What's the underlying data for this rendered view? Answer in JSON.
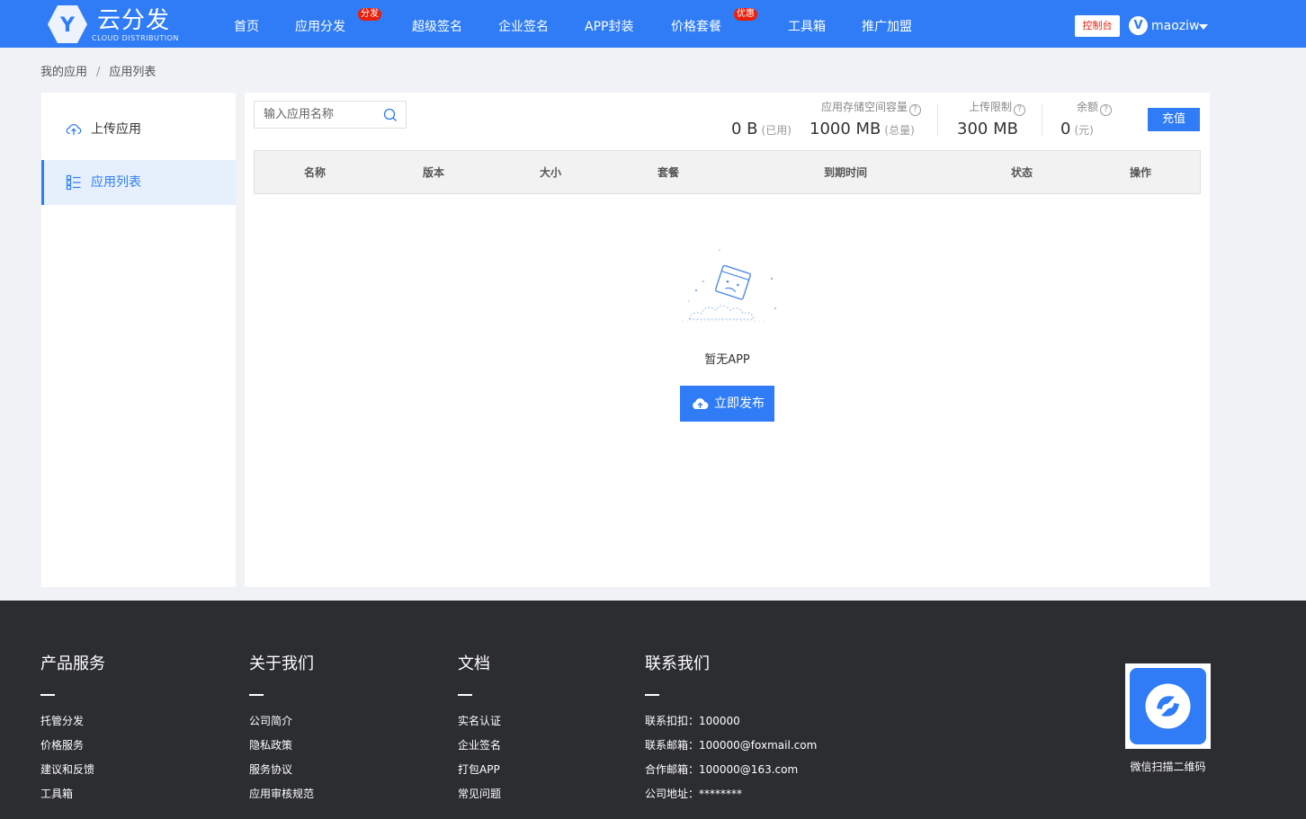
{
  "header": {
    "logo_letter": "Y",
    "logo_name": "云分发",
    "logo_sub": "CLOUD DISTRIBUTION",
    "nav": [
      {
        "label": "首页"
      },
      {
        "label": "应用分发",
        "badge": "分发"
      },
      {
        "label": "超级签名"
      },
      {
        "label": "企业签名"
      },
      {
        "label": "APP封装"
      },
      {
        "label": "价格套餐",
        "badge": "优惠"
      },
      {
        "label": "工具箱"
      },
      {
        "label": "推广加盟"
      }
    ],
    "console": "控制台",
    "user_initial": "V",
    "username": "maoziw"
  },
  "breadcrumb": [
    "我的应用",
    "应用列表"
  ],
  "breadcrumb_sep": "/",
  "sidebar": {
    "items": [
      {
        "label": "上传应用",
        "icon": "cloud-upload-icon"
      },
      {
        "label": "应用列表",
        "icon": "list-icon",
        "active": true
      }
    ]
  },
  "main": {
    "search_placeholder": "输入应用名称",
    "stats": {
      "storage_label": "应用存储空间容量",
      "used_value": "0 B",
      "used_unit": "(已用)",
      "total_value": "1000 MB",
      "total_unit": "(总量)",
      "upload_label": "上传限制",
      "upload_value": "300 MB",
      "balance_label": "余额",
      "balance_value": "0",
      "balance_unit": "(元)"
    },
    "recharge": "充值",
    "columns": [
      "名称",
      "版本",
      "大小",
      "套餐",
      "到期时间",
      "状态",
      "操作"
    ],
    "empty_text": "暂无APP",
    "publish_button": "立即发布"
  },
  "footer": {
    "columns": [
      {
        "title": "产品服务",
        "links": [
          "托管分发",
          "价格服务",
          "建议和反馈",
          "工具箱"
        ]
      },
      {
        "title": "关于我们",
        "links": [
          "公司简介",
          "隐私政策",
          "服务协议",
          "应用审核规范"
        ]
      },
      {
        "title": "文档",
        "links": [
          "实名认证",
          "企业签名",
          "打包APP",
          "常见问题"
        ]
      },
      {
        "title": "联系我们",
        "links": [
          "联系扣扣：100000",
          "联系邮箱：100000@foxmail.com",
          "合作邮箱：100000@163.com",
          "公司地址：********"
        ]
      }
    ],
    "qr_label": "微信扫描二维码"
  },
  "colors": {
    "primary": "#2f7cf6",
    "badge_red": "#e8200c",
    "footer_bg": "#2c2d30",
    "page_bg": "#f0f2f5"
  }
}
